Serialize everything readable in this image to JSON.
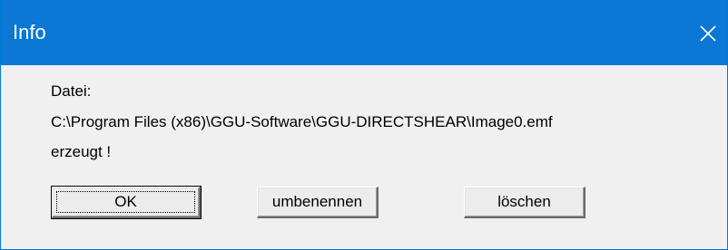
{
  "window": {
    "title": "Info",
    "close_icon": "close-icon",
    "accent": "#0a78d4"
  },
  "message": {
    "label": "Datei:",
    "path": "C:\\Program Files (x86)\\GGU-Software\\GGU-DIRECTSHEAR\\Image0.emf",
    "status": "erzeugt !"
  },
  "buttons": {
    "ok_label": "OK",
    "rename_label": "umbenennen",
    "delete_label": "löschen"
  }
}
